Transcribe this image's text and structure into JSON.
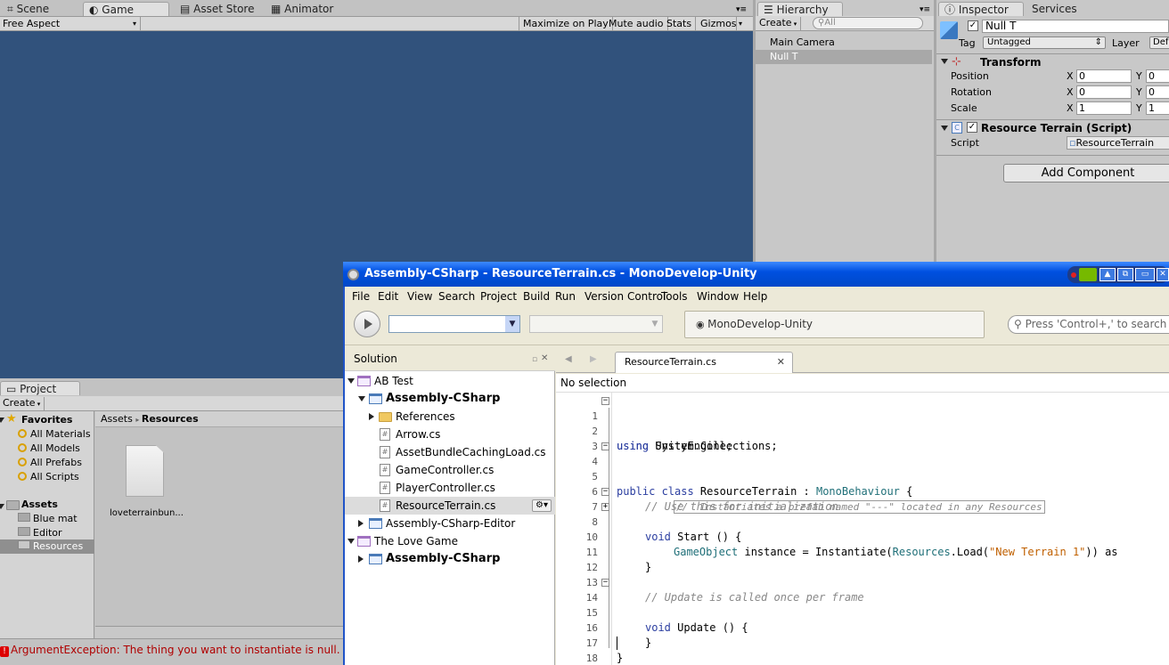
{
  "top_tabs": {
    "scene": "Scene",
    "game": "Game",
    "asset_store": "Asset Store",
    "animator": "Animator"
  },
  "game_toolbar": {
    "aspect": "Free Aspect",
    "maximize": "Maximize on Play",
    "mute": "Mute audio",
    "stats": "Stats",
    "gizmos": "Gizmos"
  },
  "hierarchy": {
    "tab": "Hierarchy",
    "create": "Create",
    "search_placeholder": "All",
    "items": [
      "Main Camera",
      "Null T"
    ]
  },
  "inspector": {
    "tab": "Inspector",
    "services_tab": "Services",
    "object_name": "Null T",
    "tag_label": "Tag",
    "tag_value": "Untagged",
    "layer_label": "Layer",
    "layer_value": "Def",
    "transform_title": "Transform",
    "position_label": "Position",
    "rotation_label": "Rotation",
    "scale_label": "Scale",
    "x": "X",
    "y": "Y",
    "position": [
      "0",
      "0"
    ],
    "rotation": [
      "0",
      "0"
    ],
    "scale": [
      "1",
      "1"
    ],
    "script_title": "Resource Terrain (Script)",
    "script_label": "Script",
    "script_value": "ResourceTerrain",
    "add_component": "Add Component"
  },
  "project": {
    "tab": "Project",
    "create": "Create",
    "favorites": "Favorites",
    "favorite_items": [
      "All Materials",
      "All Models",
      "All Prefabs",
      "All Scripts"
    ],
    "assets": "Assets",
    "asset_items": [
      "Blue mat",
      "Editor",
      "Resources"
    ],
    "breadcrumb_root": "Assets",
    "breadcrumb_current": "Resources",
    "file_label": "loveterrainbun..."
  },
  "console": {
    "error": "ArgumentException: The thing you want to instantiate is null."
  },
  "monodevelop": {
    "title": "Assembly-CSharp - ResourceTerrain.cs - MonoDevelop-Unity",
    "menu": [
      "File",
      "Edit",
      "View",
      "Search",
      "Project",
      "Build",
      "Run",
      "Version Control",
      "Tools",
      "Window",
      "Help"
    ],
    "status": "MonoDevelop-Unity",
    "search_placeholder": "Press 'Control+,' to search",
    "solution_title": "Solution",
    "tree": {
      "ab_test": "AB Test",
      "assembly_csharp": "Assembly-CSharp",
      "references": "References",
      "files": [
        "Arrow.cs",
        "AssetBundleCachingLoad.cs",
        "GameController.cs",
        "PlayerController.cs",
        "ResourceTerrain.cs"
      ],
      "assembly_editor": "Assembly-CSharp-Editor",
      "love_game": "The Love Game",
      "assembly_csharp2": "Assembly-CSharp"
    },
    "doc_tab": "ResourceTerrain.cs",
    "no_selection": "No selection",
    "line_numbers": [
      "1",
      "2",
      "3",
      "4",
      "5",
      "6",
      "7",
      "8",
      "10",
      "11",
      "12",
      "13",
      "14",
      "15",
      "16",
      "17",
      "18"
    ],
    "code": {
      "l1a": "using",
      "l1b": " UnityEngine;",
      "l2a": "using",
      "l2b": " System.Collections;",
      "l4a": "public class",
      "l4b": " ResourceTerrain : ",
      "l4c": "MonoBehaviour",
      "l4d": " {",
      "l6": "// Use this for initialization",
      "l7a": "void",
      "l7b": " Start () {",
      "l8": "//  Instantiates a prefab named \"---\" located in any Resources",
      "l10a": "GameObject",
      "l10b": " instance = Instantiate(",
      "l10c": "Resources",
      "l10d": ".Load(",
      "l10e": "\"New Terrain 1\"",
      "l10f": ")) as",
      "l11": "}",
      "l13": "// Update is called once per frame",
      "l14a": "void",
      "l14b": " Update () {",
      "l16": "}",
      "l17": "}"
    }
  }
}
